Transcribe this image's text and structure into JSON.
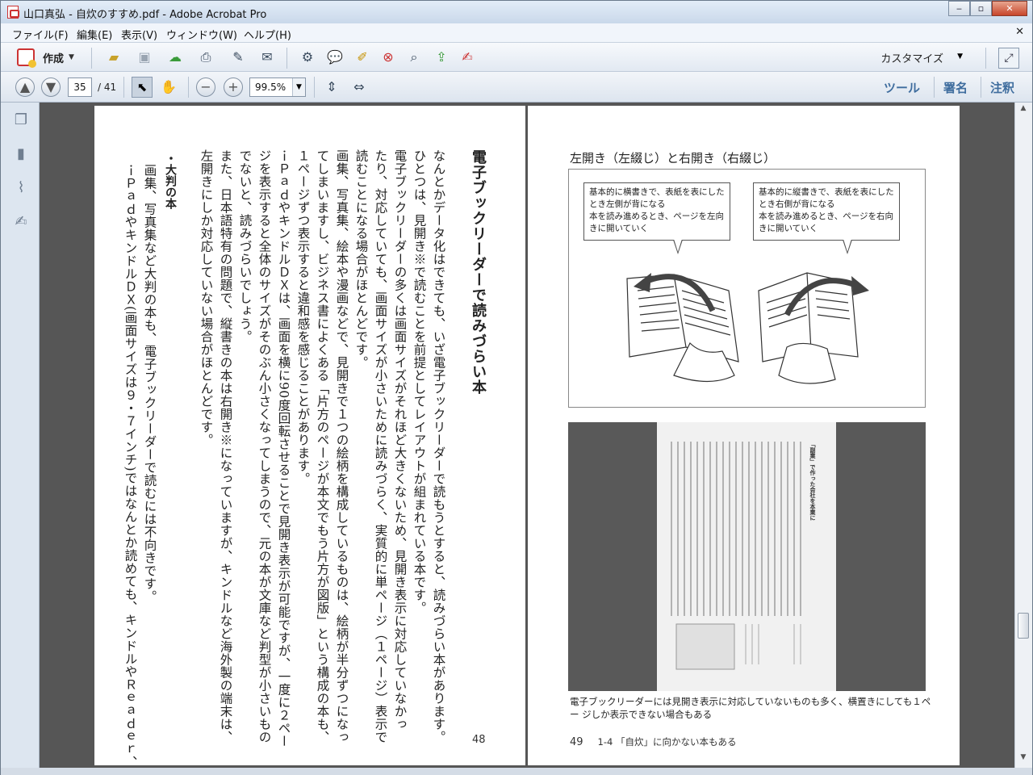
{
  "window": {
    "title": "山口真弘 - 自炊のすすめ.pdf - Adobe Acrobat Pro"
  },
  "menu": [
    "ファイル(F)",
    "編集(E)",
    "表示(V)",
    "ウィンドウ(W)",
    "ヘルプ(H)"
  ],
  "toolbar": {
    "create_label": "作成",
    "customize_label": "カスタマイズ"
  },
  "nav": {
    "current_page": "35",
    "total_pages": "/ 41",
    "zoom": "99.5%"
  },
  "right_links": {
    "tools": "ツール",
    "sign": "署名",
    "comment": "注釈"
  },
  "left_page": {
    "heading": "電子ブックリーダーで読みづらい本",
    "columns": [
      "なんとかデータ化はできても、いざ電子ブックリーダーで読もうとすると、読みづらい本があります。",
      "ひとつは、見開き※で読むことを前提としてレイアウトが組まれている本です。",
      "電子ブックリーダーの多くは画面サイズがそれほど大きくないため、見開き表示に対応していなかっ",
      "たり、対応していても、画面サイズが小さいために読みづらく、実質的に単ページ（１ページ）表示で",
      "読むことになる場合がほとんどです。",
      "画集、写真集、絵本や漫画などで、見開きで１つの絵柄を構成しているものは、絵柄が半分ずつになっ",
      "てしまいますし、ビジネス書によくある「片方のページが本文でもう片方が図版」という構成の本も、",
      "１ページずつ表示すると違和感を感じることがあります。",
      "ｉＰａｄやキンドルＤＸは、画面を横に90度回転させることで見開き表示が可能ですが、一度に２ペー",
      "ジを表示すると全体のサイズがそのぶん小さくなってしまうので、元の本が文庫など判型が小さいもの",
      "でないと、読みづらいでしょう。",
      "また、日本語特有の問題で、縦書きの本は右開き※になっていますが、キンドルなど海外製の端末は、",
      "左開きにしか対応していない場合がほとんどです。"
    ],
    "subheading": "・大判の本",
    "sub_columns": [
      "画集、写真集など大判の本も、電子ブックリーダーで読むには不向きです。",
      "ｉＰａｄやキンドルＤＸ(画面サイズは９・７インチ)ではなんとか読めても、キンドルやＲｅａｄｅｒ、"
    ],
    "page_number": "48"
  },
  "right_page": {
    "figure_title": "左開き（左綴じ）と右開き（右綴じ）",
    "bubble_left": [
      "基本的に横書きで、表紙を表にした",
      "とき左側が背になる",
      "本を読み進めるとき、ページを左向",
      "きに開いていく"
    ],
    "bubble_right": [
      "基本的に縦書きで、表紙を表にした",
      "とき右側が背になる",
      "本を読み進めるとき、ページを右向",
      "きに開いていく"
    ],
    "photo_title": "「副業」で作った会社を本業に",
    "caption": "電子ブックリーダーには見開き表示に対応していないものも多く、横置きにしても１ペー ジしか表示できない場合もある",
    "page_number": "49",
    "chapter": "1-4 「自炊」に向かない本もある"
  }
}
